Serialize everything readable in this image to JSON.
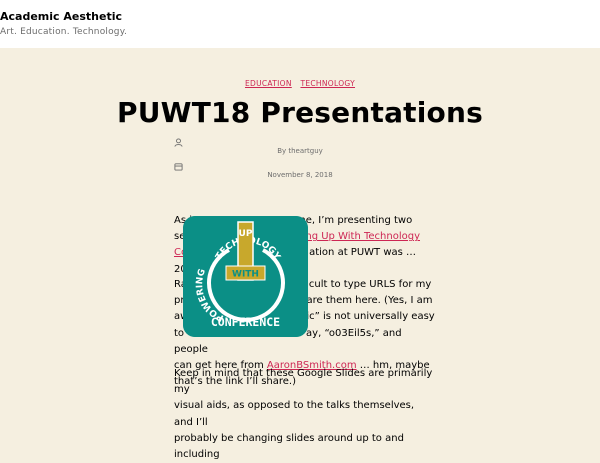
{
  "site": {
    "title": "Academic Aesthetic",
    "tagline": "Art. Education. Technology."
  },
  "post": {
    "categories": [
      "EDUCATION",
      "TECHNOLOGY"
    ],
    "title": "PUWT18 Presentations",
    "author": "By theartguy",
    "date": "November 8, 2018",
    "p1_l1_vis": "As i",
    "p1_l1_end": "me, I’m presenting two",
    "p1_l2_start": "se",
    "p1_l2_link": "ng Up With Technology",
    "p1_l3_start": "Co",
    "p1_l3_end": "ation at PUWT was …",
    "p1_l4_start": "20",
    "p2_l1_start": "Ra",
    "p2_l1_end": "cult to type URLS for my",
    "p2_l2_start": "pr",
    "p2_l2_end": "are them here. (Yes, I am",
    "p2_l3_start": "aw",
    "p2_l3_end": "ic” is not universally easy",
    "p2_l4_start": "to",
    "p2_l4_end": "ay, “o03Eil5s,” and people",
    "p2_l5_start": "can get here from ",
    "p2_l5_link": "AaronBSmith.com",
    "p2_l5_end": " … hm, maybe",
    "p2_l6": "that’s the link I’ll share.)",
    "p3_l1": "Keep in mind that these Google Slides are primarily my",
    "p3_l2": "visual aids, as opposed to the talks themselves, and I’ll",
    "p3_l3": "probably be changing slides around up to and including"
  },
  "logo": {
    "arc_top": "TECHNOLOGY",
    "arc_left": "POWERING",
    "bar_text": "UP",
    "with_text": "WITH",
    "conference": "CONFERENCE",
    "colors": {
      "teal": "#0b8f86",
      "gold": "#c8a82c",
      "white": "#ffffff"
    }
  },
  "colors": {
    "accent": "#cd2653",
    "background": "#f5efe0",
    "header": "#ffffff"
  }
}
